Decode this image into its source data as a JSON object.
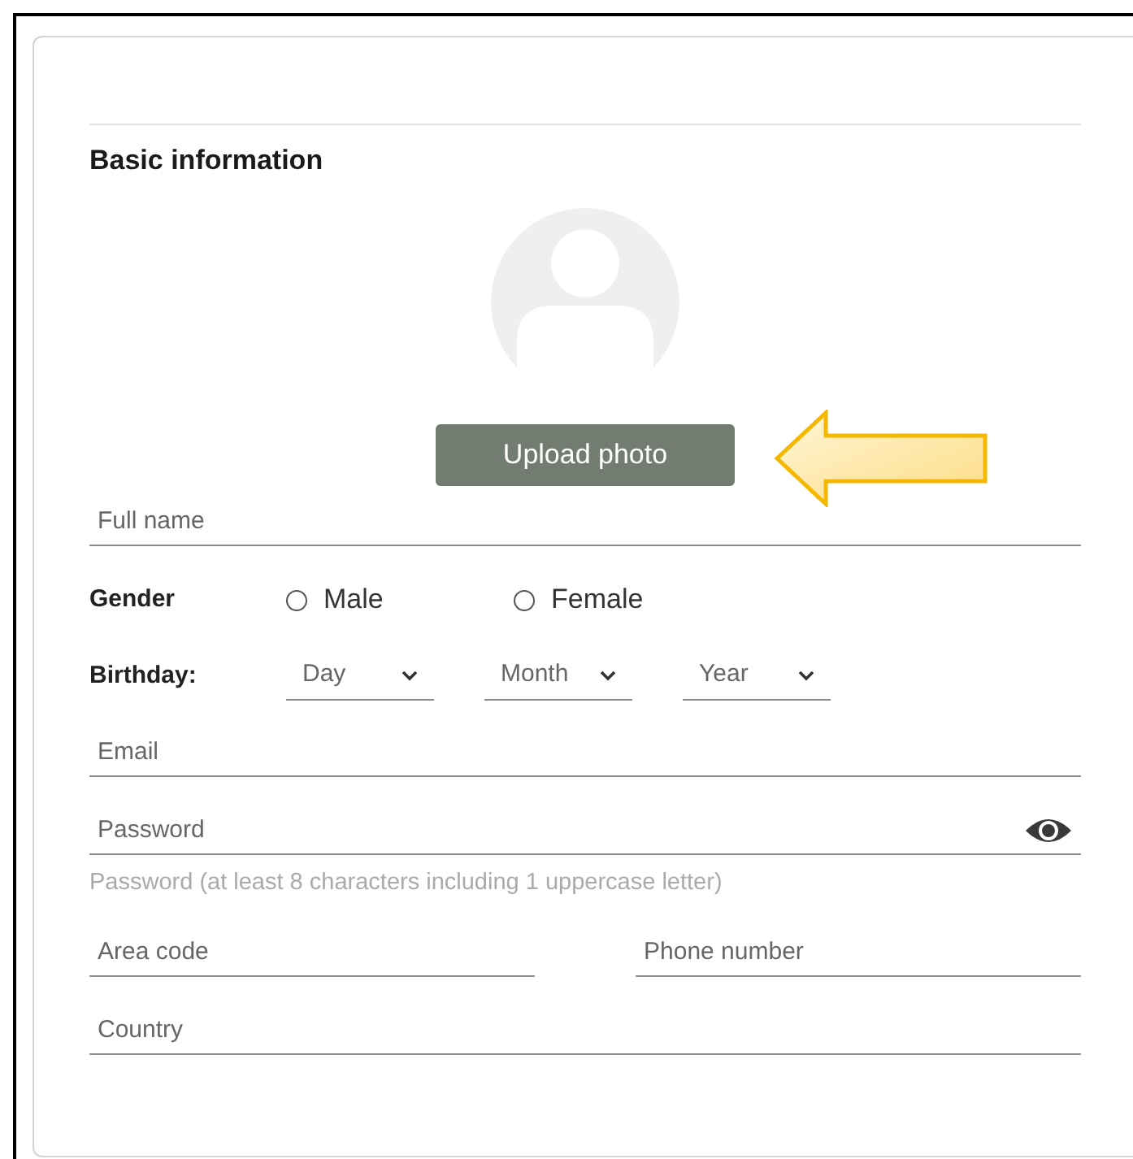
{
  "section": {
    "title": "Basic information"
  },
  "upload_button": {
    "label": "Upload photo"
  },
  "full_name": {
    "placeholder": "Full name"
  },
  "gender": {
    "label": "Gender",
    "options": [
      {
        "label": "Male",
        "selected": false
      },
      {
        "label": "Female",
        "selected": false
      }
    ]
  },
  "birthday": {
    "label": "Birthday:",
    "selects": [
      {
        "label": "Day"
      },
      {
        "label": "Month"
      },
      {
        "label": "Year"
      }
    ]
  },
  "email": {
    "placeholder": "Email"
  },
  "password": {
    "placeholder": "Password",
    "hint": "Password (at least 8 characters including 1 uppercase letter)"
  },
  "area_code": {
    "placeholder": "Area code"
  },
  "phone_number": {
    "placeholder": "Phone number"
  },
  "country": {
    "placeholder": "Country"
  }
}
